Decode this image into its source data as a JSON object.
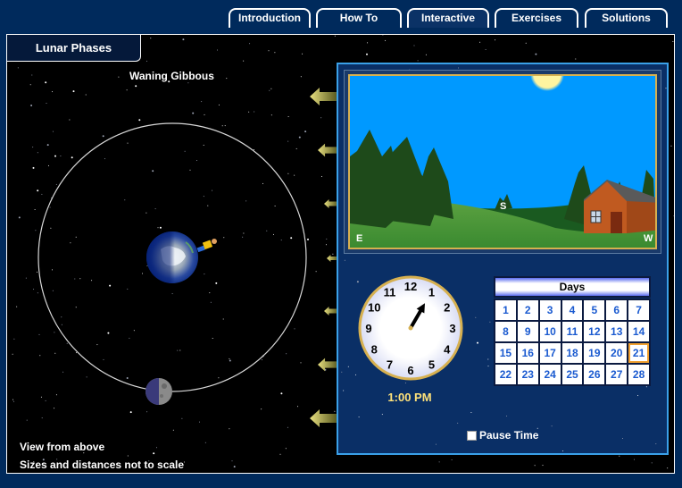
{
  "tabs": [
    {
      "label": "Introduction",
      "active": false
    },
    {
      "label": "How To",
      "active": false
    },
    {
      "label": "Interactive",
      "active": true
    },
    {
      "label": "Exercises",
      "active": false
    },
    {
      "label": "Solutions",
      "active": false
    }
  ],
  "module_title": "Lunar Phases",
  "phase_label": "Waning Gibbous",
  "captions": {
    "view": "View from above",
    "scale_note": "Sizes and distances not to scale"
  },
  "horizon_view": {
    "directions": {
      "left": "E",
      "center": "S",
      "right": "W"
    },
    "sky_color": "#0099ff",
    "moon_color": "#fff4a0"
  },
  "clock": {
    "numbers": [
      "12",
      "1",
      "2",
      "3",
      "4",
      "5",
      "6",
      "7",
      "8",
      "9",
      "10",
      "11"
    ],
    "hour": 1,
    "minute": 0,
    "time_label": "1:00 PM"
  },
  "calendar": {
    "title": "Days",
    "days": [
      1,
      2,
      3,
      4,
      5,
      6,
      7,
      8,
      9,
      10,
      11,
      12,
      13,
      14,
      15,
      16,
      17,
      18,
      19,
      20,
      21,
      22,
      23,
      24,
      25,
      26,
      27,
      28
    ],
    "selected_day": 21
  },
  "pause_time": {
    "label": "Pause Time",
    "checked": false
  },
  "icons": {
    "sunlight_arrows": "arrow-left-icon",
    "earth": "earth-icon",
    "moon": "moon-icon",
    "observer": "observer-icon"
  },
  "colors": {
    "background": "#002a5c",
    "panel": "#0a2f66",
    "panel_border": "#3aa0e8",
    "accent_gold": "#d6b050",
    "day_text": "#1a5ad0",
    "selected_day_border": "#f0a030",
    "time_text": "#ffe27a"
  }
}
